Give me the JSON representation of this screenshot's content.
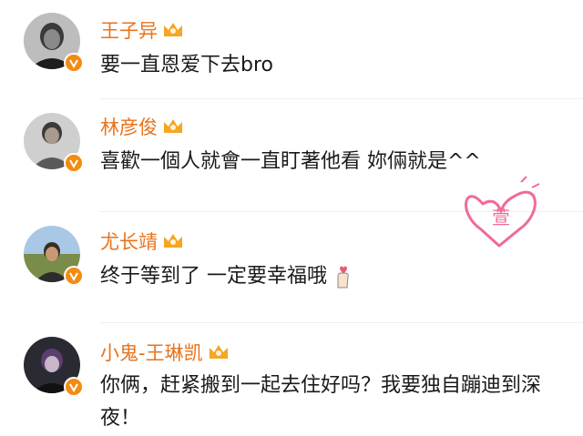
{
  "comments": [
    {
      "name": "王子异",
      "text": "要一直恩爱下去bro",
      "avatar": "avatar-photo",
      "verified": true,
      "vip_badge": "crown-icon"
    },
    {
      "name": "林彦俊",
      "text": "喜歡一個人就會一直盯著他看 妳倆就是^^",
      "avatar": "avatar-photo",
      "verified": true,
      "vip_badge": "crown-icon"
    },
    {
      "name": "尤长靖",
      "text": "终于等到了 一定要幸福哦",
      "text_emoji": "heart-hand-emoji",
      "avatar": "avatar-photo",
      "verified": true,
      "vip_badge": "crown-icon"
    },
    {
      "name": "小鬼-王琳凯",
      "text": "你俩，赶紧搬到一起去住好吗？我要独自蹦迪到深夜！",
      "avatar": "avatar-photo",
      "verified": true,
      "vip_badge": "crown-icon"
    }
  ],
  "doodle": {
    "heart_char": "萱",
    "color": "#f06a9a"
  },
  "colors": {
    "name": "#e8731a",
    "text": "#1a1a1a",
    "verified": "#f28b13"
  }
}
